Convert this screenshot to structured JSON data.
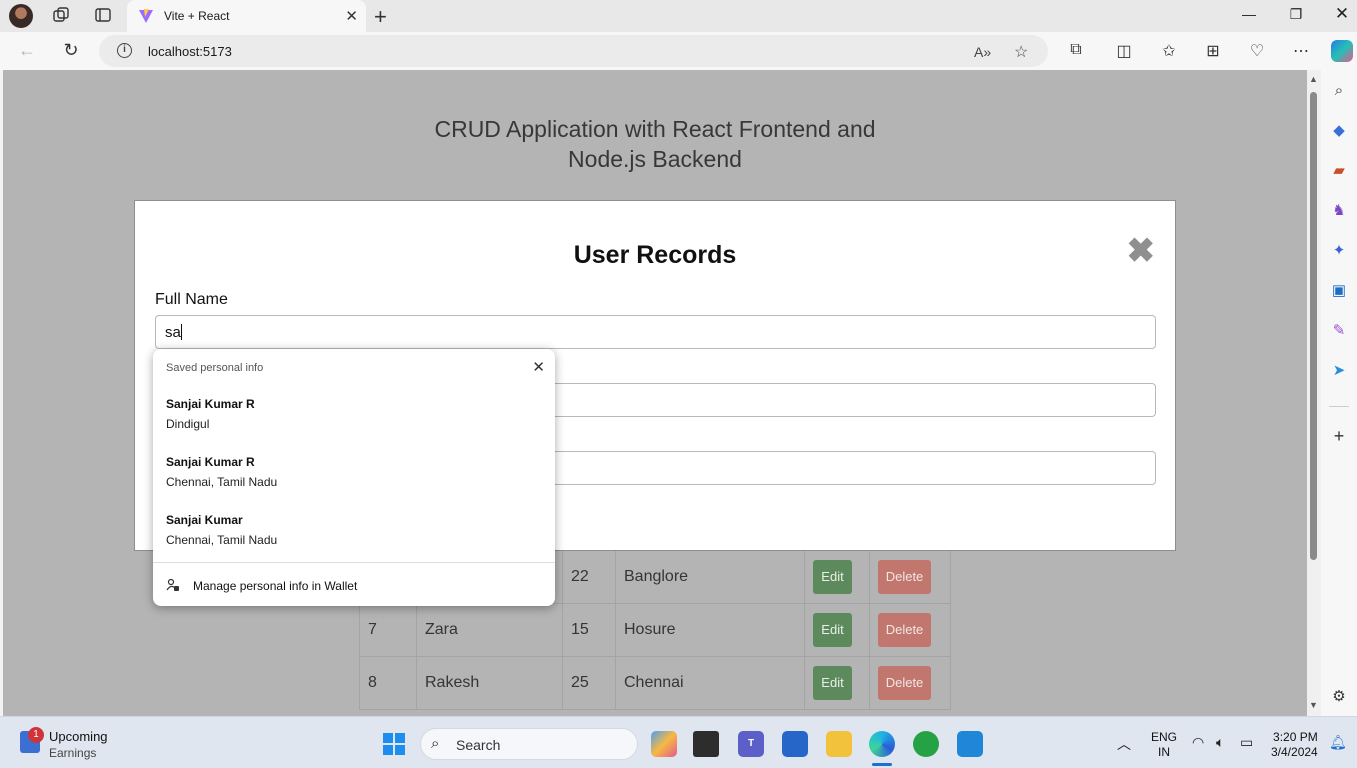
{
  "browser": {
    "tab_title": "Vite + React",
    "url": "localhost:5173"
  },
  "page": {
    "app_title_line1": "CRUD Application with React Frontend and",
    "app_title_line2": "Node.js Backend"
  },
  "modal": {
    "title": "User Records",
    "close_glyph": "✖",
    "full_name_label": "Full Name",
    "full_name_value": "sa"
  },
  "autofill": {
    "header": "Saved personal info",
    "items": [
      {
        "name": "Sanjai Kumar R",
        "address": "Dindigul"
      },
      {
        "name": "Sanjai Kumar R",
        "address": "Chennai, Tamil Nadu"
      },
      {
        "name": "Sanjai Kumar",
        "address": "Chennai, Tamil Nadu"
      }
    ],
    "manage": "Manage personal info in Wallet"
  },
  "table": {
    "rows": [
      {
        "id": "",
        "name": "",
        "age": "22",
        "city": "Banglore",
        "edit": "Edit",
        "delete": "Delete"
      },
      {
        "id": "7",
        "name": "Zara",
        "age": "15",
        "city": "Hosure",
        "edit": "Edit",
        "delete": "Delete"
      },
      {
        "id": "8",
        "name": "Rakesh",
        "age": "25",
        "city": "Chennai",
        "edit": "Edit",
        "delete": "Delete"
      }
    ]
  },
  "taskbar": {
    "widget_badge": "1",
    "widget_title": "Upcoming",
    "widget_subtitle": "Earnings",
    "search_placeholder": "Search",
    "lang_line1": "ENG",
    "lang_line2": "IN",
    "time": "3:20 PM",
    "date": "3/4/2024"
  },
  "colors": {
    "edit_button": "#5d8a5d",
    "delete_button": "#c1766e",
    "overlay": "#b4b4b4",
    "accent": "#1e6fd1"
  },
  "icons": {
    "sidebar": [
      "search-icon",
      "tag-icon",
      "toolbox-icon",
      "chess-icon",
      "copilot-icon",
      "outlook-icon",
      "drop-icon",
      "send-icon",
      "add-icon",
      "settings-icon"
    ]
  }
}
